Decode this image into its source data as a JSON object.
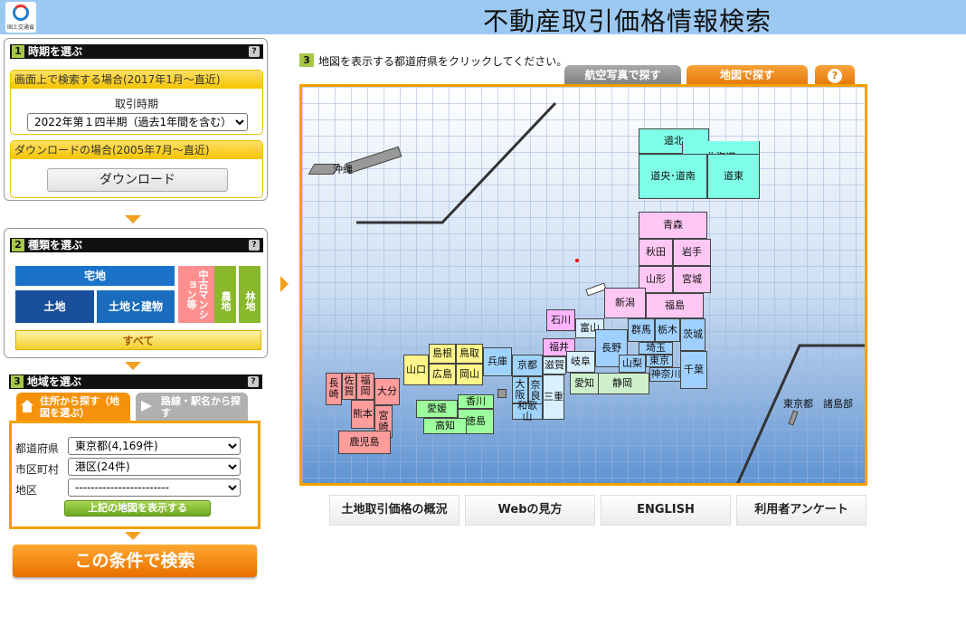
{
  "header": {
    "logo_caption": "国土交通省",
    "title": "不動産取引価格情報検索"
  },
  "step1": {
    "num": "1",
    "title": "時期を選ぶ",
    "help": "?",
    "screen_search_label": "画面上で検索する場合(2017年1月～直近)",
    "period_label": "取引時期",
    "period_value": "2022年第１四半期（過去1年間を含む）",
    "download_label": "ダウンロードの場合(2005年7月～直近)",
    "download_button": "ダウンロード"
  },
  "step2": {
    "num": "2",
    "title": "種類を選ぶ",
    "help": "?",
    "takuchi": "宅地",
    "tochi": "土地",
    "tochi_tatemono": "土地と建物",
    "chuko": "中古マンション等",
    "nochi": "農地",
    "rinchi": "林地",
    "all": "すべて"
  },
  "step3": {
    "num": "3",
    "title": "地域を選ぶ",
    "help": "?",
    "tab_address": "住所から探す（地図を選ぶ）",
    "tab_station": "路線・駅名から探す",
    "pref_label": "都道府県",
    "pref_value": "東京都(4,169件)",
    "city_label": "市区町村",
    "city_value": "港区(24件)",
    "district_label": "地区",
    "district_value": "------------------------",
    "show_map_button": "上記の地図を表示する"
  },
  "search_button": "この条件で検索",
  "map": {
    "instruction_num": "3",
    "instruction": "地図を表示する都道府県をクリックしてください。",
    "tab_aerial": "航空写真で探す",
    "tab_map": "地図で探す",
    "tab_help": "?",
    "prefs": {
      "dohoku": "道北",
      "hokkaido": "北海道",
      "doo_donan": "道央･道南",
      "doto": "道東",
      "aomori": "青森",
      "akita": "秋田",
      "iwate": "岩手",
      "yamagata": "山形",
      "miyagi": "宮城",
      "fukushima": "福島",
      "niigata": "新潟",
      "toyama": "富山",
      "ishikawa": "石川",
      "fukui": "福井",
      "nagano": "長野",
      "gunma": "群馬",
      "tochigi": "栃木",
      "ibaraki": "茨城",
      "saitama": "埼玉",
      "yamanashi": "山梨",
      "tokyo": "東京",
      "kanagawa": "神奈川",
      "chiba": "千葉",
      "gifu": "岐阜",
      "shizuoka": "静岡",
      "aichi": "愛知",
      "shiga": "滋賀",
      "kyoto": "京都",
      "osaka": "大阪",
      "nara": "奈良",
      "mie": "三重",
      "wakayama": "和歌山",
      "hyogo": "兵庫",
      "tottori": "鳥取",
      "shimane": "島根",
      "okayama": "岡山",
      "hiroshima": "広島",
      "yamaguchi": "山口",
      "kagawa": "香川",
      "tokushima": "徳島",
      "ehime": "愛媛",
      "kochi": "高知",
      "fukuoka": "福岡",
      "saga": "佐賀",
      "nagasaki": "長崎",
      "oita": "大分",
      "kumamoto": "熊本",
      "miyazaki": "宮崎",
      "kagoshima": "鹿児島",
      "okinawa": "沖縄",
      "tokyo_islands": "東京都　諸島部"
    }
  },
  "bottom_buttons": {
    "overview": "土地取引価格の概況",
    "web_guide": "Webの見方",
    "english": "ENGLISH",
    "survey": "利用者アンケート"
  },
  "colors": {
    "header": "#9cc9f2",
    "accent_orange": "#f5a000",
    "step_green": "#a7c847"
  }
}
